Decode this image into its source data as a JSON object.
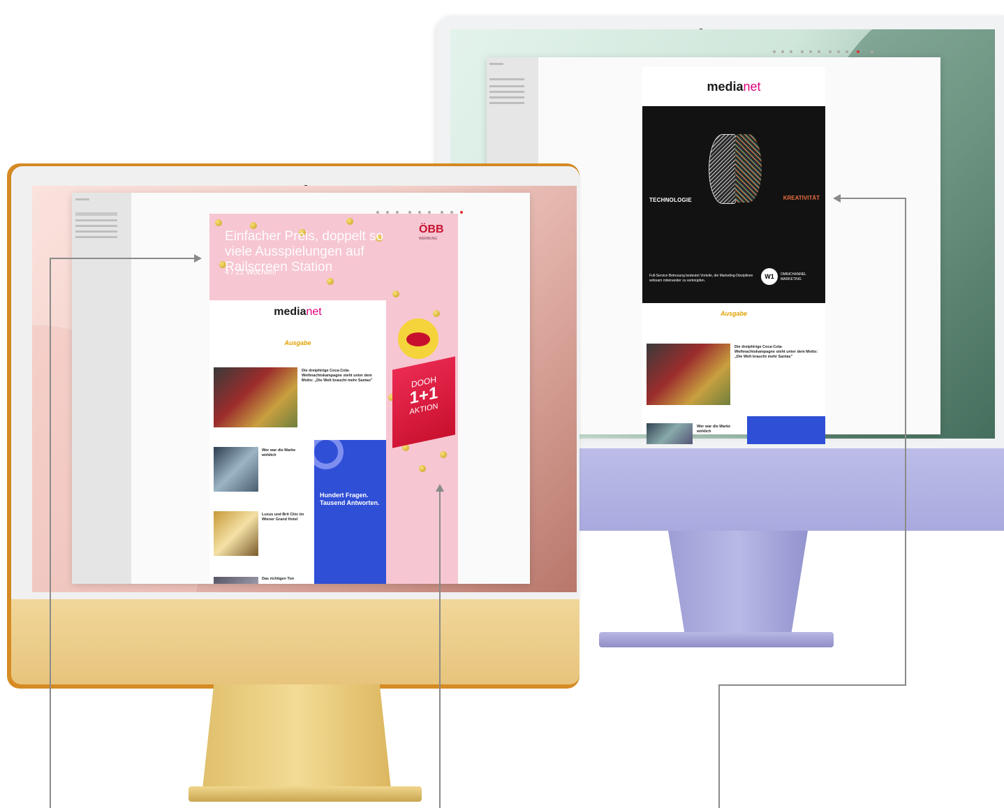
{
  "back_monitor": {
    "email": {
      "logo_main": "media",
      "logo_accent": "net",
      "hero_left_label": "TECHNOLOGIE",
      "hero_right_label": "KREATIVITÄT",
      "hero_caption": "Full-Service Betreuung bedeutet Vorteile, die Marketing-Disziplinen wirksam miteinander zu verknüpfen.",
      "sponsor_mark": "W1",
      "sponsor_name": "OMNICHANNEL MARKETING",
      "issue_label": "Ausgabe",
      "article1_title": "Die dreiphirige Coca-Cola-Weihnachtskampagne steht unter dem Motto: „Die Welt braucht mehr Santas\"",
      "article2_title": "Wer war die Marke wirklich"
    }
  },
  "front_monitor": {
    "ad": {
      "headline": "Einfacher Preis, doppelt so viele Ausspielungen auf Railscreen Station",
      "subline": "4 / 21 Wochen!",
      "brand": "ÖBB",
      "brand_sub": "WERBUNG",
      "promo_top": "DOOH",
      "promo_big": "1+1",
      "promo_bottom": "AKTION"
    },
    "email": {
      "logo_main": "media",
      "logo_accent": "net",
      "issue_label": "Ausgabe",
      "article1_title": "Die dreiphirige Coca-Cola-Weihnachtskampagne steht unter dem Motto: „Die Welt braucht mehr Santas\"",
      "article2_title": "Wer war die Marke wirklich",
      "article3_title": "Luxus und Brit Chic im Wiener Grand Hotel",
      "article4_title": "Das richtigen Ton",
      "side_banner": "Hundert Fragen. Tausend Antworten."
    }
  },
  "colors": {
    "front_body": "#e7c47c",
    "back_body": "#a9a9df",
    "ad_pink": "#f6c6d2",
    "accent_red": "#c8102e",
    "banner_blue": "#2f4fd6"
  }
}
